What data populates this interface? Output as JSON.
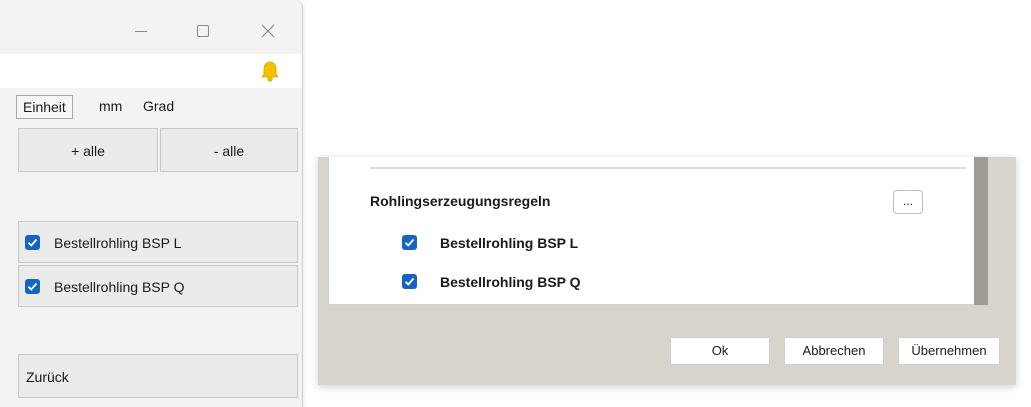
{
  "left_window": {
    "unit_label": "Einheit",
    "unit_mm": "mm",
    "unit_deg": "Grad",
    "add_all": "+ alle",
    "remove_all": "- alle",
    "items": [
      {
        "label": "Bestellrohling BSP L",
        "checked": true
      },
      {
        "label": "Bestellrohling BSP Q",
        "checked": true
      }
    ],
    "back": "Zurück",
    "bell_color": "#f5c000"
  },
  "dialog": {
    "section_title": "Rohlingserzeugungsregeln",
    "more_button": "...",
    "rules": [
      {
        "label": "Bestellrohling BSP L",
        "checked": true
      },
      {
        "label": "Bestellrohling BSP Q",
        "checked": true
      }
    ],
    "buttons": {
      "ok": "Ok",
      "cancel": "Abbrechen",
      "apply": "Übernehmen"
    }
  },
  "colors": {
    "checkbox": "#1565c0",
    "dialog_bg": "#d8d4cc"
  }
}
